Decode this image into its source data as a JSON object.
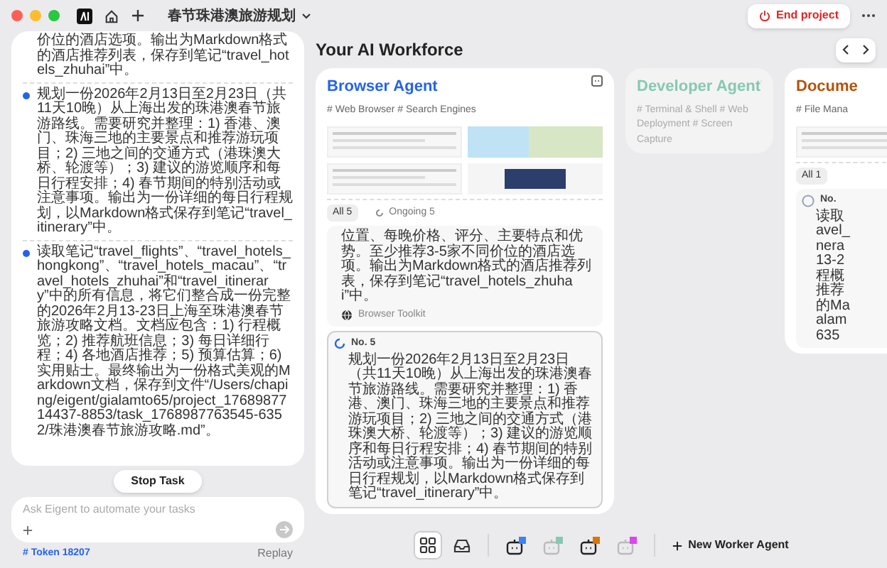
{
  "window": {
    "title": "春节珠港澳旅游规划",
    "end_button": "End project"
  },
  "chat": {
    "items": [
      {
        "continued": true,
        "text": "价位的酒店选项。输出为Markdown格式的酒店推荐列表，保存到笔记“travel_hotels_zhuhai”中。"
      },
      {
        "continued": false,
        "text": "规划一份2026年2月13日至2月23日（共11天10晚）从上海出发的珠港澳春节旅游路线。需要研究并整理：1) 香港、澳门、珠海三地的主要景点和推荐游玩项目；2) 三地之间的交通方式（港珠澳大桥、轮渡等）；3) 建议的游览顺序和每日行程安排；4) 春节期间的特别活动或注意事项。输出为一份详细的每日行程规划，以Markdown格式保存到笔记“travel_itinerary”中。"
      },
      {
        "continued": false,
        "text": "读取笔记“travel_flights”、“travel_hotels_hongkong”、“travel_hotels_macau”、“travel_hotels_zhuhai”和“travel_itinerary”中的所有信息，将它们整合成一份完整的2026年2月13-23日上海至珠港澳春节旅游攻略文档。文档应包含：1) 行程概览；2) 推荐航班信息；3) 每日详细行程；4) 各地酒店推荐；5) 预算估算；6) 实用贴士。最终输出为一份格式美观的Markdown文档，保存到文件“/Users/chaping/eigent/gialamto65/project_1768987714437-8853/task_1768987763545-6352/珠港澳春节旅游攻略.md”。"
      }
    ],
    "stop_button": "Stop Task",
    "input": {
      "placeholder": "Ask Eigent to automate your tasks"
    },
    "token": "# Token 18207",
    "replay": "Replay"
  },
  "workforce": {
    "title": "Your AI Workforce",
    "agents": [
      {
        "name": "Browser Agent",
        "color": "#2563eb",
        "active": true,
        "tags": "# Web Browser # Search Engines",
        "thumbnails": [
          {
            "kind": "page"
          },
          {
            "kind": "map"
          },
          {
            "kind": "page"
          },
          {
            "kind": "photo"
          }
        ],
        "tabs": [
          {
            "label": "All 5",
            "selected": true
          },
          {
            "label": "Ongoing 5",
            "selected": false
          }
        ],
        "tasks": [
          {
            "kind": "plain",
            "text": "位置、每晚价格、评分、主要特点和优势。至少推荐3-5家不同价位的酒店选项。输出为Markdown格式的酒店推荐列表，保存到笔记“travel_hotels_zhuhai”中。",
            "toolkit": "Browser Toolkit"
          },
          {
            "kind": "running",
            "number": "No. 5",
            "text": "规划一份2026年2月13日至2月23日（共11天10晚）从上海出发的珠港澳春节旅游路线。需要研究并整理：1) 香港、澳门、珠海三地的主要景点和推荐游玩项目；2) 三地之间的交通方式（港珠澳大桥、轮渡等）；3) 建议的游览顺序和每日行程安排；4) 春节期间的特别活动或注意事项。输出为一份详细的每日行程规划，以Markdown格式保存到笔记“travel_itinerary”中。"
          }
        ]
      },
      {
        "name": "Developer Agent",
        "color": "#86c9b0",
        "active": false,
        "tags": "# Terminal & Shell # Web Deployment # Screen Capture"
      },
      {
        "name": "Docume",
        "color": "#b45309",
        "active": true,
        "tags": "# File Mana",
        "thumbnails": [
          {
            "kind": "page"
          }
        ],
        "tabs": [
          {
            "label": "All 1",
            "selected": true
          }
        ],
        "tasks": [
          {
            "kind": "pending",
            "number": "No.",
            "lines": [
              "读取",
              "avel_",
              "nera",
              "13-2",
              "程概",
              "推荐",
              "的Ma",
              "alam",
              "635"
            ]
          }
        ]
      }
    ]
  },
  "toolbar": {
    "agents": [
      {
        "color": "#3b82f6",
        "active": true
      },
      {
        "color": "#86c9b0",
        "active": false
      },
      {
        "color": "#d97706",
        "active": true
      },
      {
        "color": "#d946ef",
        "active": false
      }
    ],
    "new_agent": "New Worker Agent"
  }
}
